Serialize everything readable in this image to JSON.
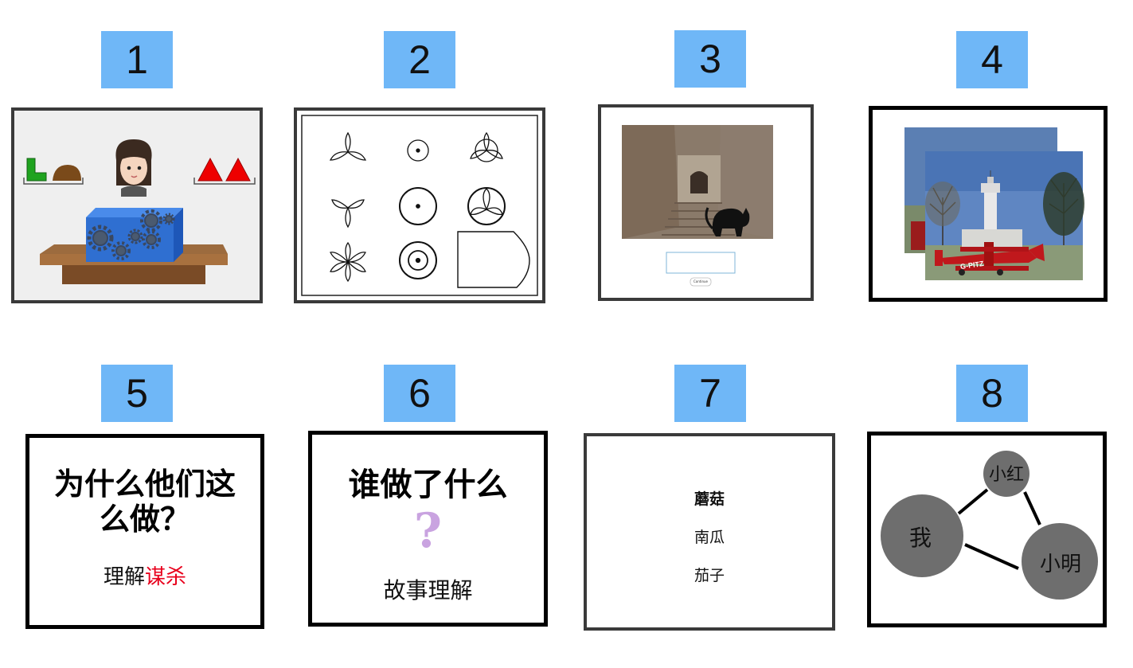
{
  "tiles": [
    {
      "number": "1"
    },
    {
      "number": "2"
    },
    {
      "number": "3",
      "button_label": "Continue"
    },
    {
      "number": "4",
      "plane_registration": "G-PITZ"
    },
    {
      "number": "5",
      "title": "为什么他们这么做？",
      "subtitle_prefix": "理解",
      "subtitle_highlight": "谋杀"
    },
    {
      "number": "6",
      "title": "谁做了什么",
      "question_mark": "?",
      "subtitle": "故事理解"
    },
    {
      "number": "7",
      "items": [
        "蘑菇",
        "南瓜",
        "茄子"
      ]
    },
    {
      "number": "8",
      "nodes": [
        "小红",
        "我",
        "小明"
      ]
    }
  ],
  "colors": {
    "number_badge": "#6fb7f7",
    "highlight_red": "#e8001c",
    "question_purple": "#c9a3e0",
    "node_gray": "#6e6e6e",
    "cube_blue": "#2f6fd1"
  }
}
